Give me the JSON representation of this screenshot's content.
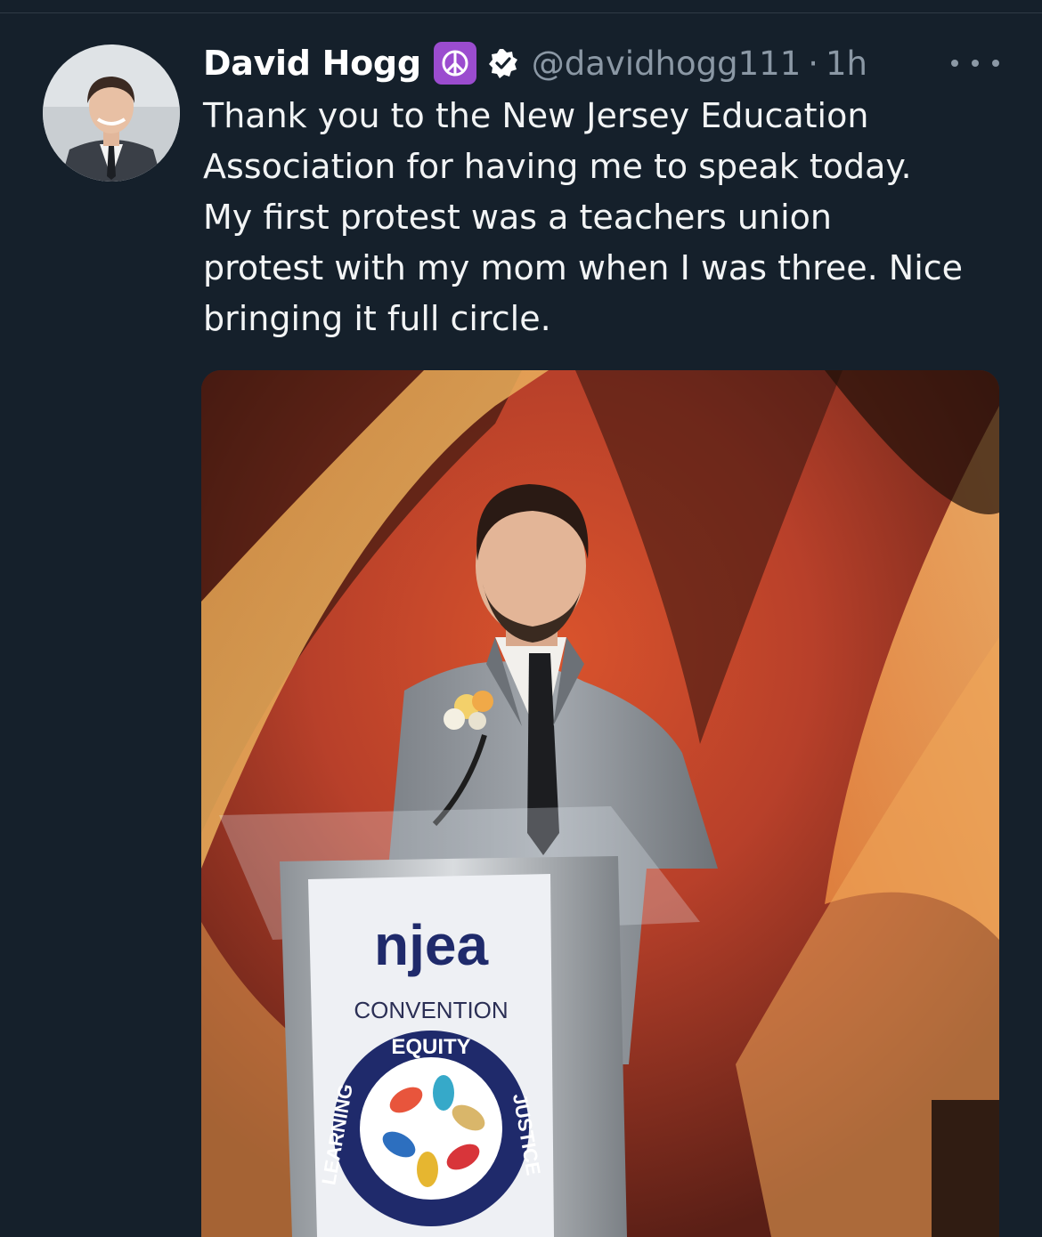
{
  "tweet": {
    "author_name": "David Hogg",
    "name_emoji": "☮",
    "handle": "@davidhogg111",
    "separator": "·",
    "timestamp": "1h",
    "text": "Thank you to the New Jersey Education\nAssociation for having me to speak today.\nMy first protest was a teachers union\nprotest with my mom when I was three. Nice\nbringing it full circle."
  },
  "icons": {
    "more": "more-horizontal-icon",
    "verified": "verified-badge-icon",
    "peace": "peace-symbol-icon"
  },
  "photo": {
    "podium_brand": "njea",
    "podium_subtitle": "CONVENTION",
    "seal_words": [
      "EQUITY",
      "JUSTICE",
      "LEARNING"
    ]
  },
  "colors": {
    "background": "#15202b",
    "secondary_text": "#8b98a5",
    "badge_purple": "#9b4ccf"
  }
}
